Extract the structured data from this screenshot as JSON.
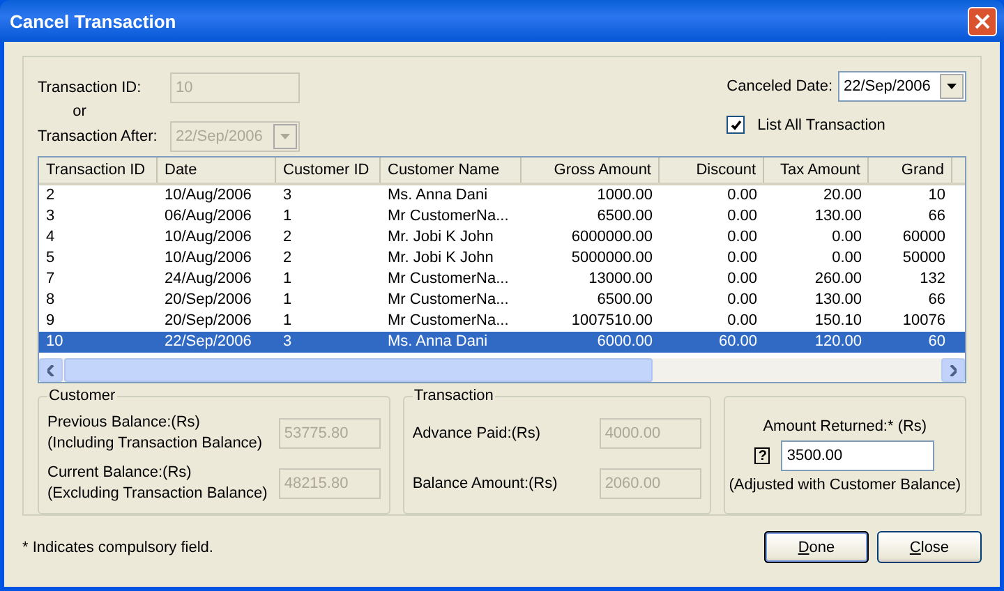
{
  "window": {
    "title": "Cancel Transaction"
  },
  "filter": {
    "transaction_id_label": "Transaction ID:",
    "transaction_id": {
      "value": "10",
      "disabled": true
    },
    "or_label": "or",
    "transaction_after_label": "Transaction After:",
    "transaction_after": {
      "value": "22/Sep/2006",
      "disabled": true
    },
    "canceled_date_label": "Canceled Date:",
    "canceled_date": {
      "value": "22/Sep/2006",
      "disabled": false
    },
    "list_all": {
      "label": "List All Transaction",
      "checked": true
    }
  },
  "table": {
    "columns": [
      {
        "label": "Transaction ID",
        "kind": "text"
      },
      {
        "label": "Date",
        "kind": "text"
      },
      {
        "label": "Customer ID",
        "kind": "text"
      },
      {
        "label": "Customer Name",
        "kind": "text"
      },
      {
        "label": "Gross Amount",
        "kind": "amount"
      },
      {
        "label": "Discount",
        "kind": "amount"
      },
      {
        "label": "Tax Amount",
        "kind": "amount"
      },
      {
        "label": "Grand",
        "kind": "amount"
      }
    ],
    "rows": [
      {
        "cells": [
          "2",
          "10/Aug/2006",
          "3",
          "Ms. Anna Dani",
          "1000.00",
          "0.00",
          "20.00",
          "10"
        ],
        "selected": false
      },
      {
        "cells": [
          "3",
          "06/Aug/2006",
          "1",
          "Mr CustomerNa...",
          "6500.00",
          "0.00",
          "130.00",
          "66"
        ],
        "selected": false
      },
      {
        "cells": [
          "4",
          "10/Aug/2006",
          "2",
          "Mr. Jobi K John",
          "6000000.00",
          "0.00",
          "0.00",
          "60000"
        ],
        "selected": false
      },
      {
        "cells": [
          "5",
          "10/Aug/2006",
          "2",
          "Mr. Jobi K John",
          "5000000.00",
          "0.00",
          "0.00",
          "50000"
        ],
        "selected": false
      },
      {
        "cells": [
          "7",
          "24/Aug/2006",
          "1",
          "Mr CustomerNa...",
          "13000.00",
          "0.00",
          "260.00",
          "132"
        ],
        "selected": false
      },
      {
        "cells": [
          "8",
          "20/Sep/2006",
          "1",
          "Mr CustomerNa...",
          "6500.00",
          "0.00",
          "130.00",
          "66"
        ],
        "selected": false
      },
      {
        "cells": [
          "9",
          "20/Sep/2006",
          "1",
          "Mr CustomerNa...",
          "1007510.00",
          "0.00",
          "150.10",
          "10076"
        ],
        "selected": false
      },
      {
        "cells": [
          "10",
          "22/Sep/2006",
          "3",
          "Ms. Anna Dani",
          "6000.00",
          "60.00",
          "120.00",
          "60"
        ],
        "selected": true
      }
    ]
  },
  "customer": {
    "title": "Customer",
    "fields": [
      {
        "label": "Previous Balance:(Rs)",
        "sublabel": "(Including Transaction Balance)",
        "value": "53775.80",
        "disabled": true
      },
      {
        "label": "Current Balance:(Rs)",
        "sublabel": "(Excluding Transaction Balance)",
        "value": "48215.80",
        "disabled": true
      }
    ]
  },
  "transaction": {
    "title": "Transaction",
    "fields": [
      {
        "label": "Advance Paid:(Rs)",
        "value": "4000.00",
        "disabled": true
      },
      {
        "label": "Balance Amount:(Rs)",
        "value": "2060.00",
        "disabled": true
      }
    ]
  },
  "amount_returned": {
    "label": "Amount Returned:* (Rs)",
    "help": "?",
    "value": "3500.00",
    "note": "(Adjusted with Customer Balance)"
  },
  "footnote": "* Indicates compulsory field.",
  "buttons": [
    {
      "label": "Done",
      "default": true
    },
    {
      "label": "Close",
      "default": false
    }
  ]
}
